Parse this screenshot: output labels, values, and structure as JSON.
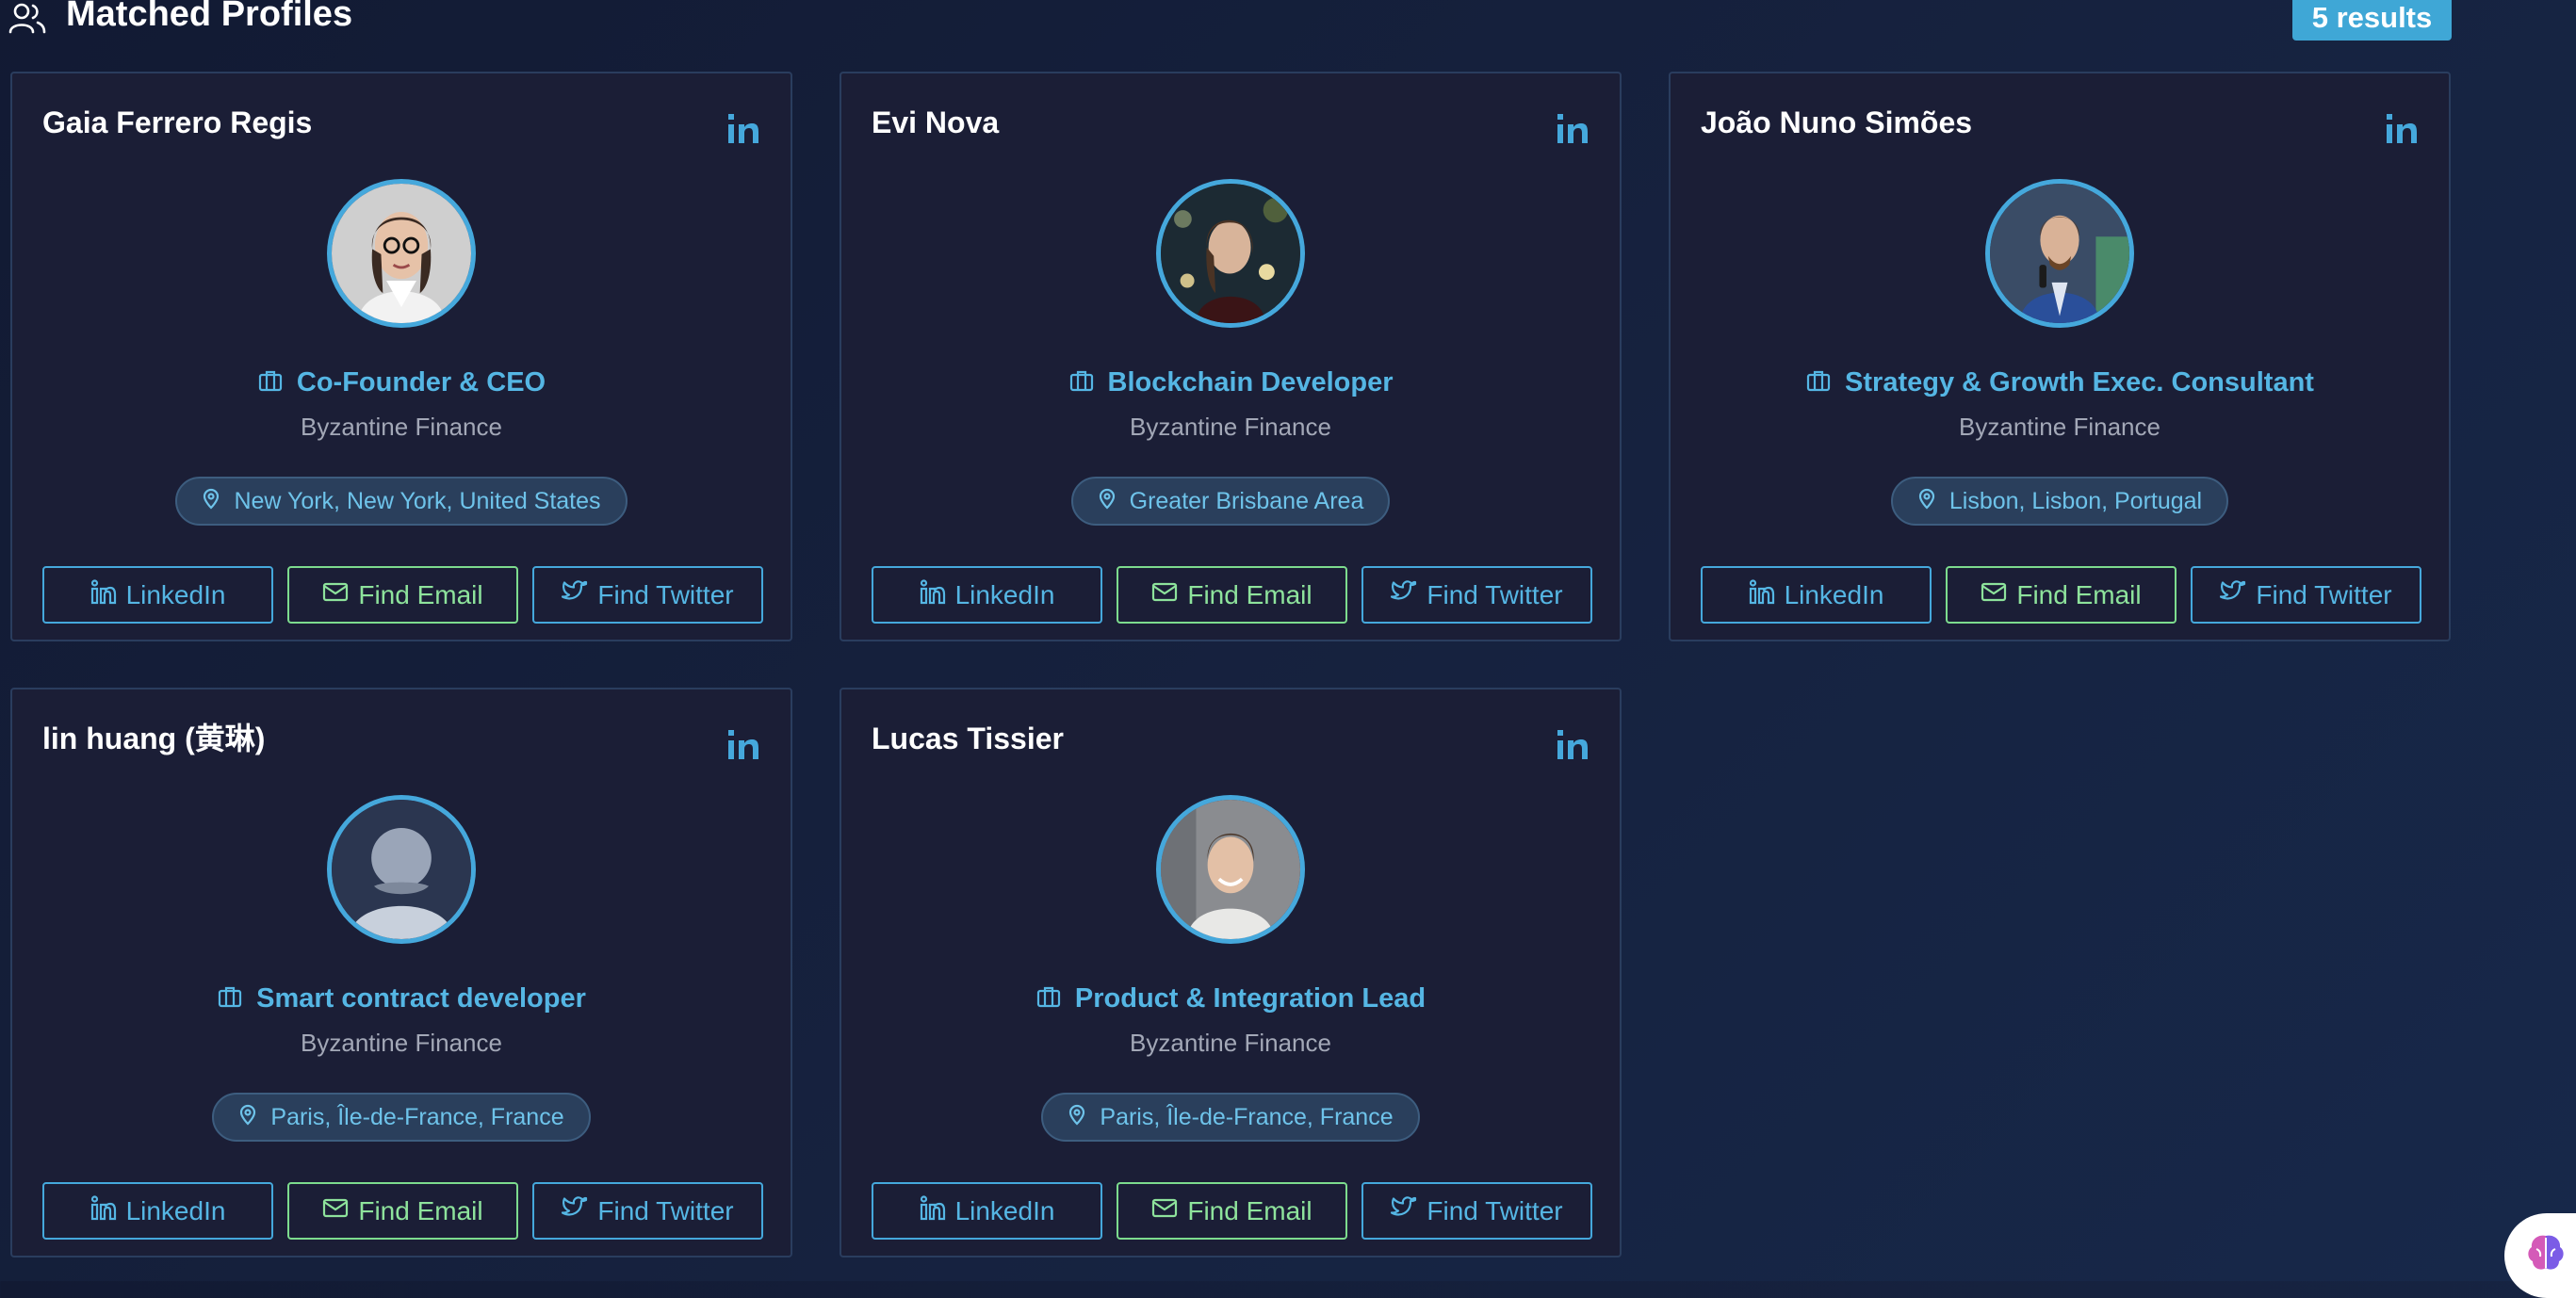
{
  "header": {
    "title": "Matched Profiles",
    "results": "5 results"
  },
  "buttons": {
    "linkedin": "LinkedIn",
    "email": "Find Email",
    "twitter": "Find Twitter"
  },
  "colors": {
    "accent": "#45a8dc",
    "email_accent": "#7ddc8e",
    "card_bg": "#1b1e36",
    "page_bg": "#16223f"
  },
  "profiles": [
    {
      "name": "Gaia Ferrero Regis",
      "title": "Co-Founder & CEO",
      "company": "Byzantine Finance",
      "location": "New York, New York, United States",
      "avatar": "photo"
    },
    {
      "name": "Evi Nova",
      "title": "Blockchain Developer",
      "company": "Byzantine Finance",
      "location": "Greater Brisbane Area",
      "avatar": "photo"
    },
    {
      "name": "João Nuno Simões",
      "title": "Strategy & Growth Exec. Consultant",
      "company": "Byzantine Finance",
      "location": "Lisbon, Lisbon, Portugal",
      "avatar": "photo"
    },
    {
      "name": "lin huang (黄琳)",
      "title": "Smart contract developer",
      "company": "Byzantine Finance",
      "location": "Paris, Île-de-France, France",
      "avatar": "placeholder"
    },
    {
      "name": "Lucas Tissier",
      "title": "Product & Integration Lead",
      "company": "Byzantine Finance",
      "location": "Paris, Île-de-France, France",
      "avatar": "photo"
    }
  ]
}
